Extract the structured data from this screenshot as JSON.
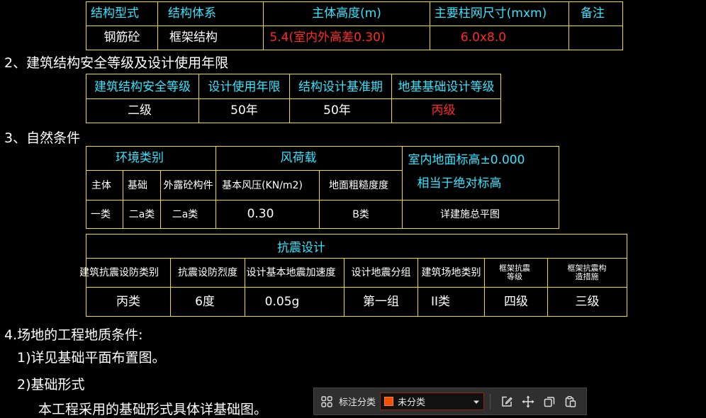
{
  "table1": {
    "headers": [
      "结构型式",
      "结构体系",
      "主体高度(m)",
      "主要柱网尺寸(mxm)",
      "备注"
    ],
    "row": [
      "钢筋砼",
      "框架结构",
      "5.4(室内外高差0.30)",
      "6.0x8.0",
      ""
    ]
  },
  "section2": {
    "title": "2、建筑结构安全等级及设计使用年限"
  },
  "table2": {
    "headers": [
      "建筑结构安全等级",
      "设计使用年限",
      "结构设计基准期",
      "地基基础设计等级"
    ],
    "row": [
      "二级",
      "50年",
      "50年",
      "丙级"
    ]
  },
  "section3": {
    "title": "3、自然条件"
  },
  "table3": {
    "group_env": "环境类别",
    "group_wind": "风荷载",
    "elevation_line1": "室内地面标高±0.000",
    "elevation_line2": "相当于绝对标高",
    "sub_headers": [
      "主体",
      "基础",
      "外露砼构件",
      "基本风压(KN/m2)",
      "地面粗糙度度"
    ],
    "row": [
      "一类",
      "二a类",
      "二a类",
      "0.30",
      "B类",
      "详建施总平图"
    ]
  },
  "table4": {
    "title": "抗震设计",
    "headers": [
      "建筑抗震设防类别",
      "抗震设防烈度",
      "设计基本地震加速度",
      "设计地震分组",
      "建筑场地类别",
      "框架抗震等级",
      "框架抗震构造措施"
    ],
    "row": [
      "丙类",
      "6度",
      "0.05g",
      "第一组",
      "II类",
      "四级",
      "三级"
    ]
  },
  "section4": {
    "title": "4.场地的工程地质条件:",
    "item1": "1)详见基础平面布置图。",
    "item2": "2)基础形式",
    "item2_text": "本工程采用的基础形式具体详基础图。"
  },
  "toolbar": {
    "label": "标注分类",
    "select_value": "未分类",
    "swatch_color": "#f05000",
    "icons": [
      "select-group-icon",
      "edit-icon",
      "move-icon",
      "copy-icon",
      "paste-icon"
    ]
  }
}
